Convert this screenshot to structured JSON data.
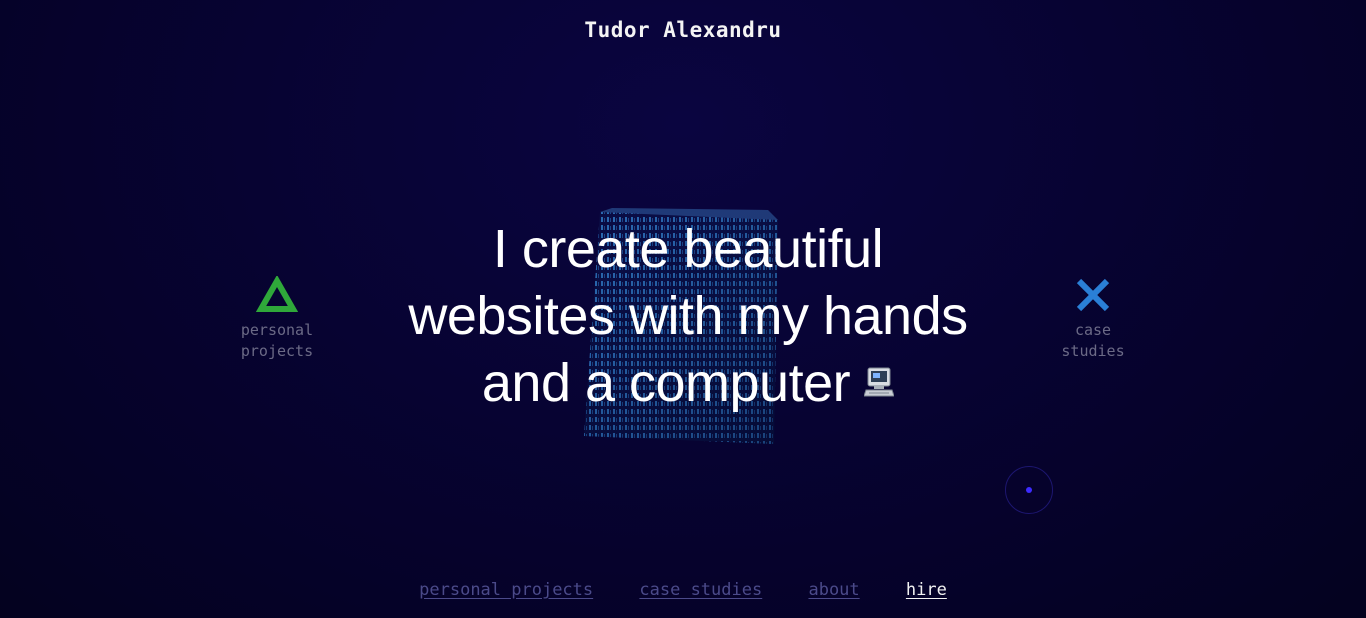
{
  "header": {
    "title": "Tudor Alexandru"
  },
  "hero": {
    "lines": [
      "I create beautiful",
      "websites with my hands",
      "and a computer"
    ],
    "emoji_icon": "desktop-computer-icon"
  },
  "side_links": {
    "left": {
      "label_line1": "personal",
      "label_line2": "projects",
      "icon": "triangle-icon",
      "color": "#2fa83a"
    },
    "right": {
      "label_line1": "case",
      "label_line2": "studies",
      "icon": "cross-icon",
      "color": "#2a7fd6"
    }
  },
  "nav": {
    "items": [
      {
        "label": "personal projects",
        "active": false
      },
      {
        "label": "case studies",
        "active": false
      },
      {
        "label": "about",
        "active": false
      },
      {
        "label": "hire",
        "active": true
      }
    ]
  },
  "colors": {
    "background": "#070332",
    "nav_inactive": "#4b4a8a",
    "nav_active": "#f2f2f2",
    "side_label": "#6b6a86",
    "cube": "#2b74c9"
  }
}
